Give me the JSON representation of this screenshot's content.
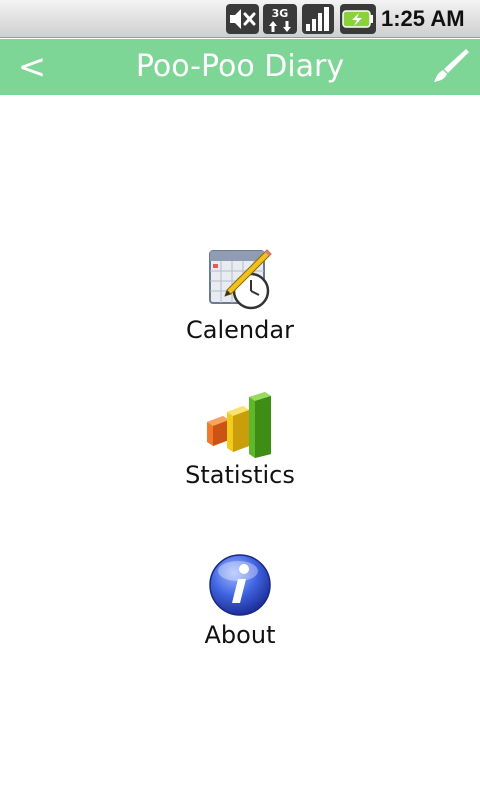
{
  "status_bar": {
    "time": "1:25 AM",
    "icons": [
      "mute-icon",
      "3g-data-icon",
      "signal-icon",
      "battery-charging-icon"
    ]
  },
  "header": {
    "back_label": "<",
    "title": "Poo-Poo Diary",
    "action_icon": "brush-icon"
  },
  "menu": {
    "items": [
      {
        "label": "Calendar",
        "icon": "calendar-clock-icon"
      },
      {
        "label": "Statistics",
        "icon": "bar-chart-icon"
      },
      {
        "label": "About",
        "icon": "info-icon"
      }
    ]
  },
  "colors": {
    "header_bg": "#7dd596",
    "header_text": "#ffffff",
    "body_bg": "#ffffff",
    "label_text": "#111111"
  }
}
